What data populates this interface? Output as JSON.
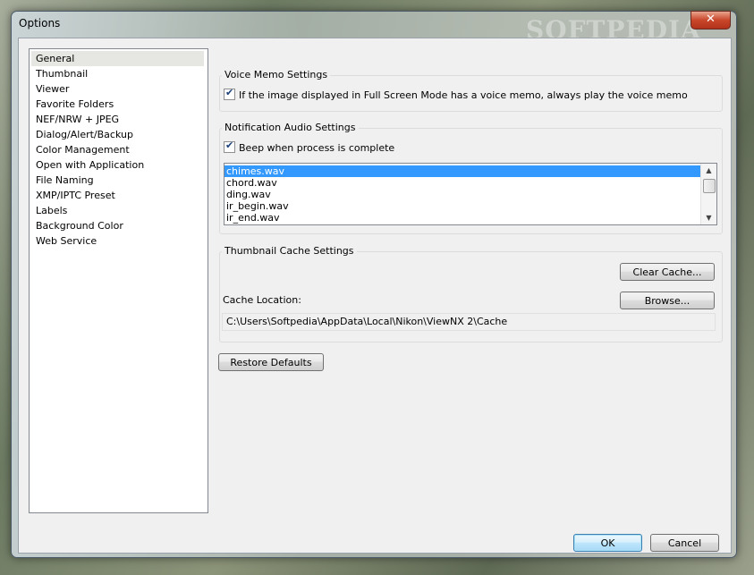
{
  "window": {
    "title": "Options",
    "watermark": "SOFTPEDIA",
    "close_glyph": "✕"
  },
  "nav": {
    "items": [
      {
        "label": "General",
        "selected": true
      },
      {
        "label": "Thumbnail"
      },
      {
        "label": "Viewer"
      },
      {
        "label": "Favorite Folders"
      },
      {
        "label": "NEF/NRW + JPEG"
      },
      {
        "label": "Dialog/Alert/Backup"
      },
      {
        "label": "Color Management"
      },
      {
        "label": "Open with Application"
      },
      {
        "label": "File Naming"
      },
      {
        "label": "XMP/IPTC Preset"
      },
      {
        "label": "Labels"
      },
      {
        "label": "Background Color"
      },
      {
        "label": "Web Service"
      }
    ]
  },
  "voice_memo": {
    "title": "Voice Memo Settings",
    "checkbox_label": "If the image displayed in Full Screen Mode has a voice memo, always play the voice memo",
    "checked": true
  },
  "notification": {
    "title": "Notification Audio Settings",
    "checkbox_label": "Beep when process is complete",
    "checked": true,
    "sounds": [
      "chimes.wav",
      "chord.wav",
      "ding.wav",
      "ir_begin.wav",
      "ir_end.wav"
    ],
    "selected_sound": "chimes.wav"
  },
  "thumbnail_cache": {
    "title": "Thumbnail Cache Settings",
    "clear_button": "Clear Cache...",
    "location_label": "Cache Location:",
    "browse_button": "Browse...",
    "location_value": "C:\\Users\\Softpedia\\AppData\\Local\\Nikon\\ViewNX 2\\Cache"
  },
  "buttons": {
    "restore": "Restore Defaults",
    "ok": "OK",
    "cancel": "Cancel"
  },
  "glyphs": {
    "check": "✔",
    "arrow_up": "▲",
    "arrow_down": "▼"
  }
}
